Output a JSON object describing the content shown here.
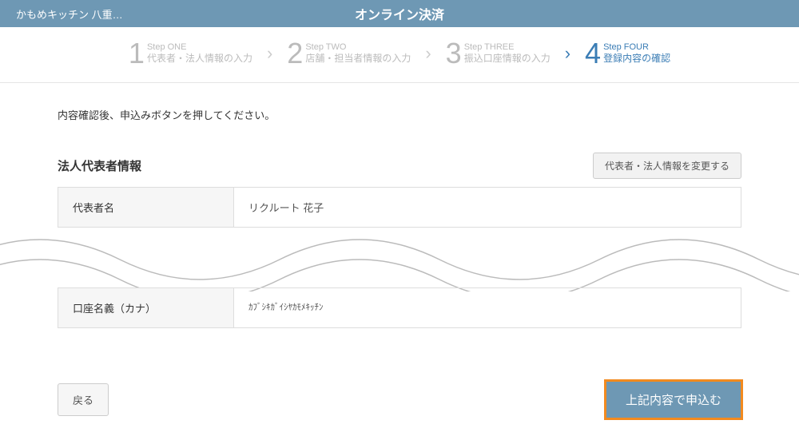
{
  "header": {
    "shop_name": "かもめキッチン 八重…",
    "title": "オンライン決済"
  },
  "steps": [
    {
      "num": "1",
      "label": "Step ONE",
      "desc": "代表者・法人情報の入力",
      "active": false
    },
    {
      "num": "2",
      "label": "Step TWO",
      "desc": "店舗・担当者情報の入力",
      "active": false
    },
    {
      "num": "3",
      "label": "Step THREE",
      "desc": "振込口座情報の入力",
      "active": false
    },
    {
      "num": "4",
      "label": "Step FOUR",
      "desc": "登録内容の確認",
      "active": true
    }
  ],
  "instruction": "内容確認後、申込みボタンを押してください。",
  "section1": {
    "title": "法人代表者情報",
    "edit_button": "代表者・法人情報を変更する",
    "rows": [
      {
        "label": "代表者名",
        "value": "リクルート 花子"
      }
    ]
  },
  "section2": {
    "rows": [
      {
        "label": "口座名義（カナ）",
        "value": "ｶﾌﾞｼｷｶﾞｲｼﾔｶﾓﾒｷｯﾁﾝ"
      }
    ]
  },
  "buttons": {
    "back": "戻る",
    "submit": "上記内容で申込む"
  }
}
